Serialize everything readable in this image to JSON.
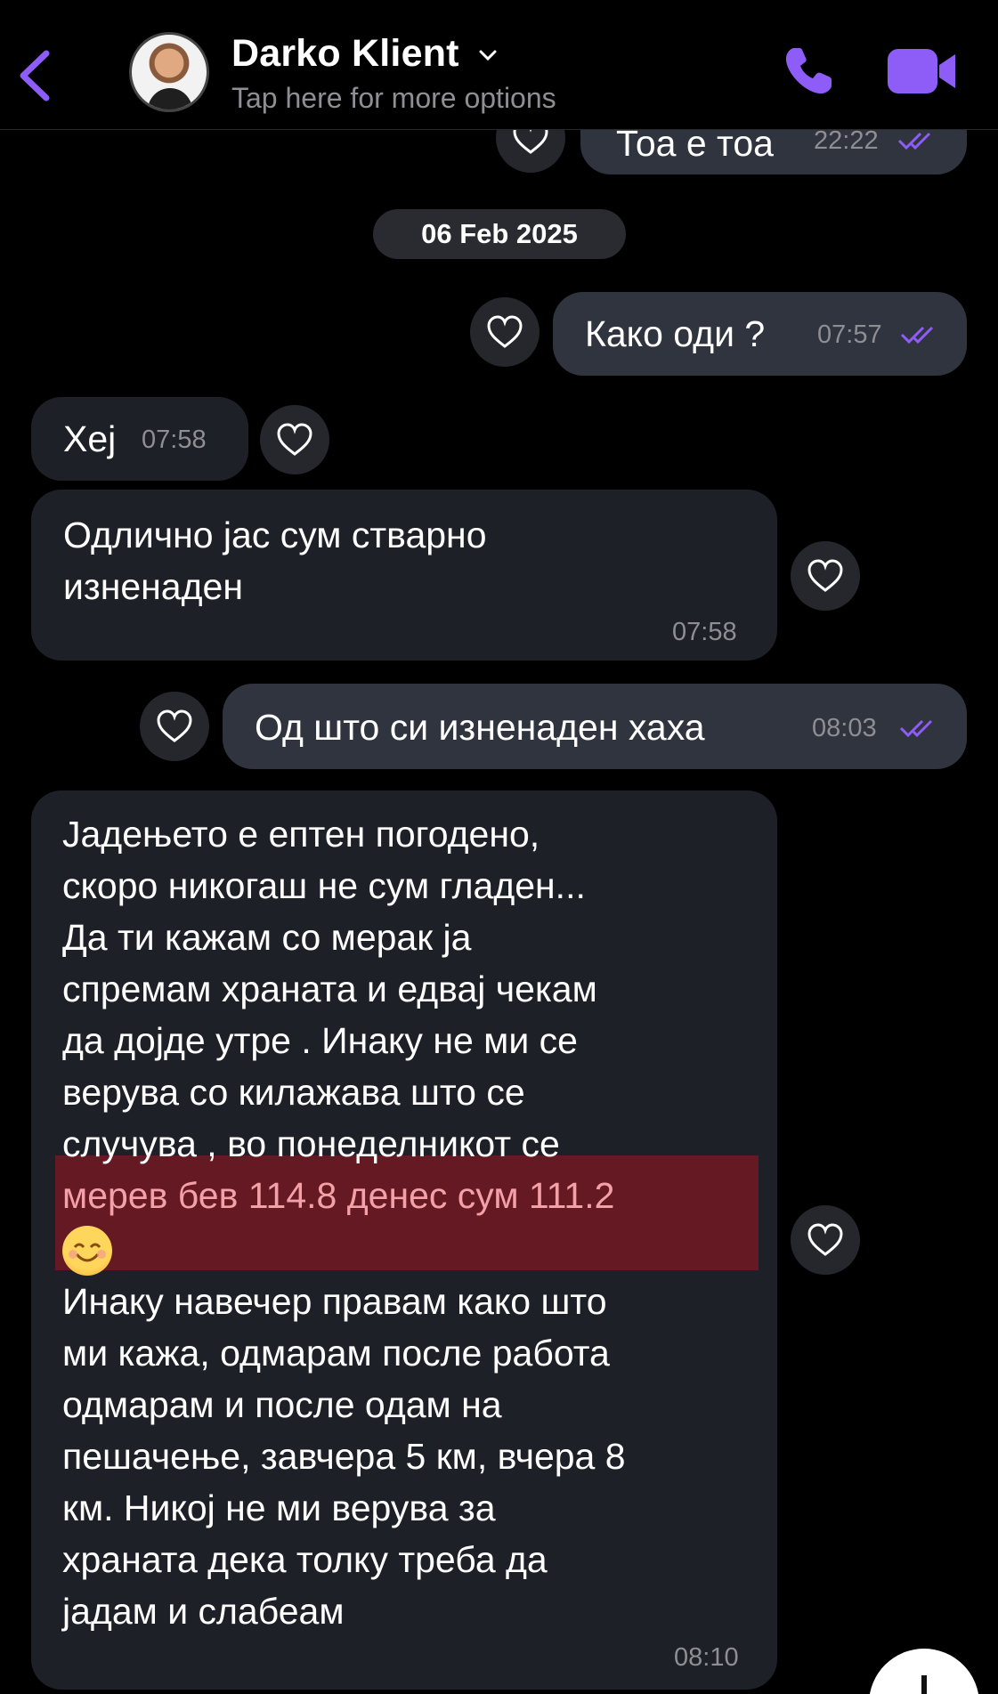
{
  "contact": {
    "name": "Darko Klient",
    "subtitle": "Tap here for more options"
  },
  "colors": {
    "accent": "#8e5cf7",
    "incoming_bubble": "#1e2028",
    "outgoing_bubble": "#30343f",
    "highlight": "#8b1a24"
  },
  "date_separator": "06 Feb 2025",
  "messages": [
    {
      "direction": "out",
      "text": "Тоа е тоа",
      "time": "22:22"
    },
    {
      "direction": "out",
      "text": "Како оди ?",
      "time": "07:57"
    },
    {
      "direction": "in",
      "text": "Хеј",
      "time": "07:58"
    },
    {
      "direction": "in",
      "lines": [
        "Одлично јас сум стварно",
        "изненаден"
      ],
      "time": "07:58"
    },
    {
      "direction": "out",
      "text": "Од што си изненаден хаха",
      "time": "08:03"
    },
    {
      "direction": "in",
      "lines": [
        "Јадењето е ептен погодено,",
        "скоро никогаш не сум гладен...",
        "Да ти кажам со мерак ја",
        "спремам храната и едвај чекам",
        "да дојде утре . Инаку не ми се",
        "верува со килажава што се",
        "случува , во понеделникот се",
        "мерев бев 114.8 денес сум 111.2",
        "Инаку навечер правам како што",
        "ми кажа, одмарам после работа",
        "одмарам и после одам на",
        "пешачење, завчера 5 км, вчера 8",
        "км. Никој не ми верува за",
        "храната дека толку треба да",
        "јадам и слабеам"
      ],
      "emoji": "smiling-face",
      "time": "08:10"
    }
  ]
}
